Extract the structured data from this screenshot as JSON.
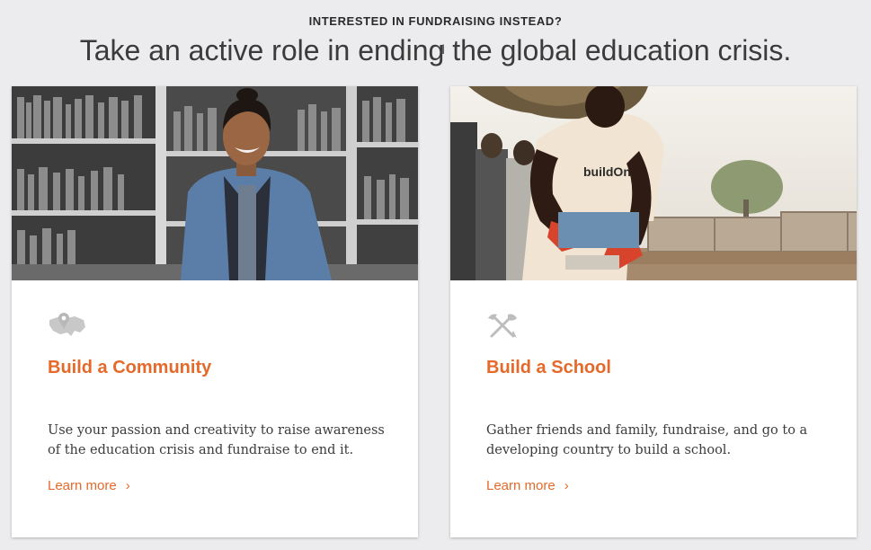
{
  "header": {
    "eyebrow": "INTERESTED IN FUNDRAISING INSTEAD?",
    "headline": "Take an active role in ending the global education crisis."
  },
  "cards": [
    {
      "icon": "us-map-pin-icon",
      "photo": "student-in-library-photo",
      "title": "Build a Community",
      "description": "Use your passion and creativity to raise awareness of the education crisis and fundraise to end it.",
      "link_label": "Learn more"
    },
    {
      "icon": "shovel-pickaxe-icon",
      "photo": "man-building-school-photo",
      "title": "Build a School",
      "description": "Gather friends and family, fundraise, and go to a developing country to build a school.",
      "link_label": "Learn more"
    }
  ],
  "colors": {
    "accent": "#e5692a",
    "background": "#ececee",
    "card": "#ffffff",
    "text": "#3c3c3c"
  }
}
